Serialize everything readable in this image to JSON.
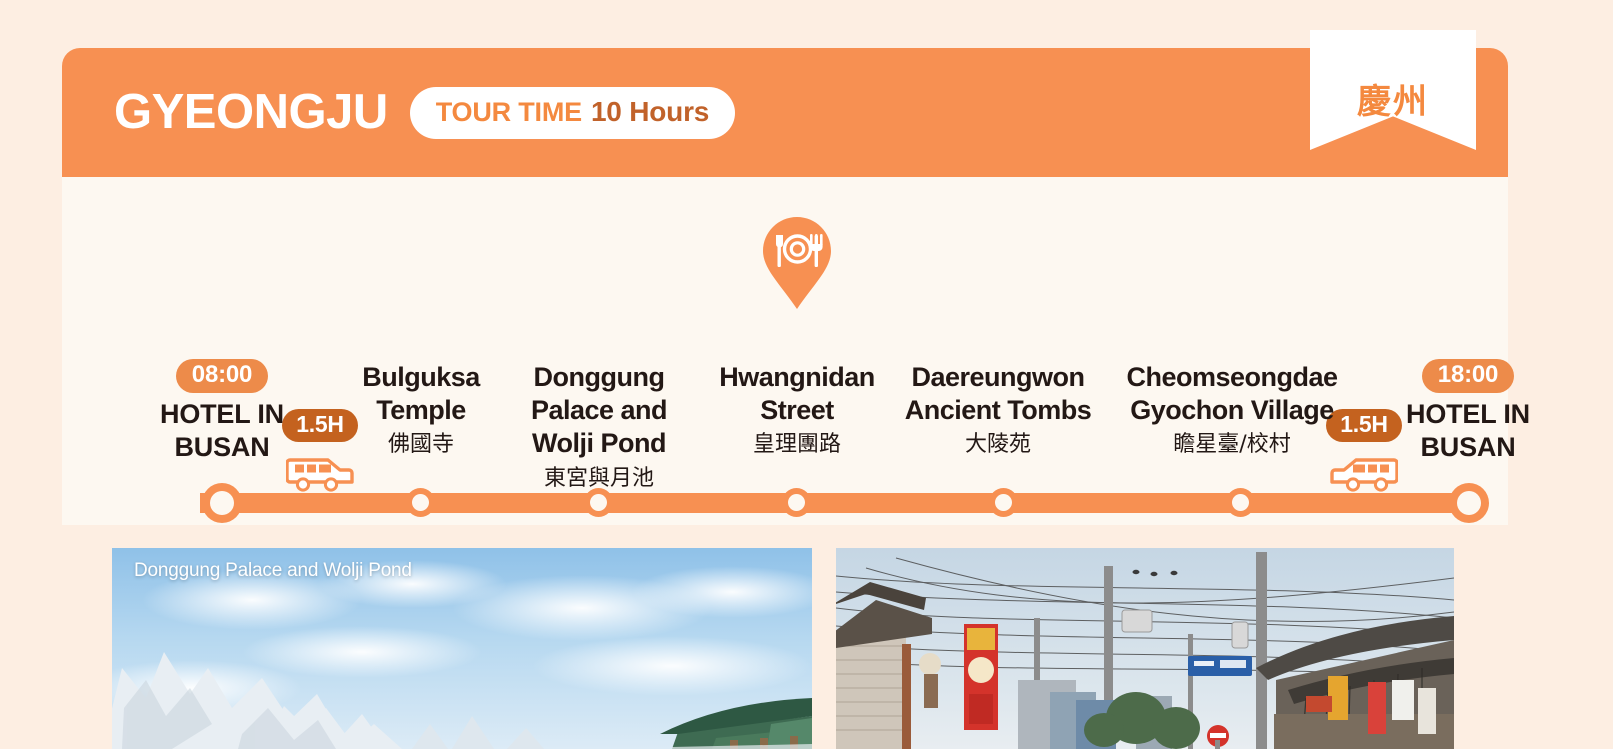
{
  "header": {
    "city": "GYEONGJU",
    "tour_time_label": "TOUR TIME",
    "tour_time_value": "10 Hours",
    "ribbon_text": "慶州",
    "band_color": "#F79052",
    "pill_bg": "#FFFFFF",
    "pill_label_color": "#F4893F",
    "pill_value_color": "#C1622A"
  },
  "timeline": {
    "card_bg": "#FDF8F1",
    "track_color": "#F79052",
    "stops": [
      {
        "id": "hotel-start",
        "time": "08:00",
        "name_en": "HOTEL IN BUSAN",
        "name_cn": "",
        "node": "big"
      },
      {
        "id": "bulguksa",
        "time": "",
        "name_en": "Bulguksa Temple",
        "name_cn": "佛國寺",
        "node": "small"
      },
      {
        "id": "donggung",
        "time": "",
        "name_en": "Donggung Palace and Wolji Pond",
        "name_cn": "東宮與月池",
        "node": "small"
      },
      {
        "id": "hwangnidan",
        "time": "",
        "name_en": "Hwangnidan Street",
        "name_cn": "皇理團路",
        "node": "small"
      },
      {
        "id": "daereungwon",
        "time": "",
        "name_en": "Daereungwon Ancient Tombs",
        "name_cn": "大陵苑",
        "node": "small"
      },
      {
        "id": "cheomseongdae",
        "time": "",
        "name_en": "Cheomseongdae Gyochon Village",
        "name_cn": "瞻星臺/校村",
        "node": "small"
      },
      {
        "id": "hotel-end",
        "time": "18:00",
        "name_en": "HOTEL IN BUSAN",
        "name_cn": "",
        "node": "big"
      }
    ],
    "legs": [
      {
        "id": "leg-outbound",
        "duration": "1.5H",
        "icon": "bus-icon",
        "badge_color": "#C4621F"
      },
      {
        "id": "leg-return",
        "duration": "1.5H",
        "icon": "bus-icon",
        "badge_color": "#C4621F"
      }
    ],
    "meal_marker": {
      "id": "meal-stop",
      "icon": "restaurant-pin-icon",
      "color": "#F79052"
    },
    "time_badge_color": "#ED8B4A"
  },
  "photos": [
    {
      "id": "photo-donggung",
      "caption": "Donggung Palace and Wolji Pond",
      "scene": "winter-snow-pines-sky"
    },
    {
      "id": "photo-street",
      "caption": "",
      "scene": "korean-street-hanok-signs"
    }
  ]
}
